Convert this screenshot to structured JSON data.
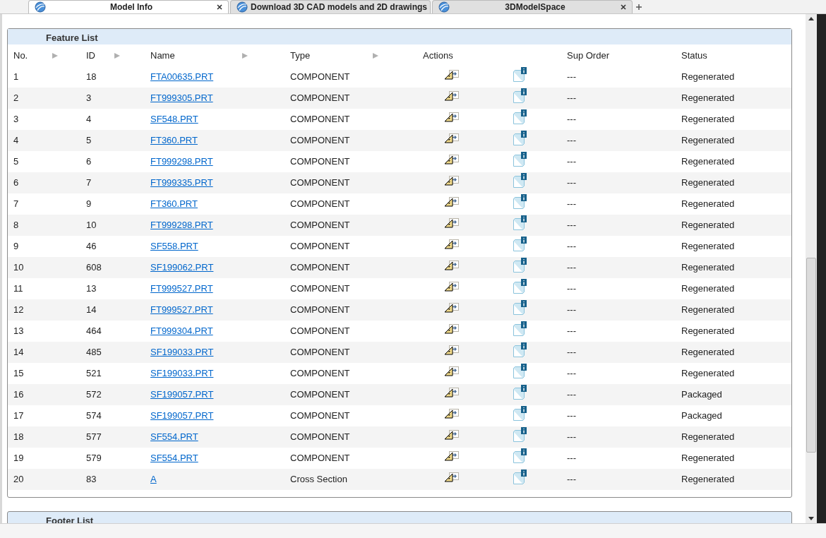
{
  "tabs": [
    {
      "label": "Model Info",
      "selected": true
    },
    {
      "label": "Download 3D CAD models and 2D drawings",
      "selected": false
    },
    {
      "label": "3DModelSpace",
      "selected": false
    }
  ],
  "feature_list": {
    "title": "Feature List",
    "columns": [
      {
        "label": "No.",
        "sortable": true
      },
      {
        "label": "ID",
        "sortable": true
      },
      {
        "label": "Name",
        "sortable": true
      },
      {
        "label": "Type",
        "sortable": true
      },
      {
        "label": "Actions",
        "sortable": false
      },
      {
        "label": "Sup Order",
        "sortable": false
      },
      {
        "label": "Status",
        "sortable": false
      }
    ],
    "rows": [
      {
        "no": "1",
        "id": "18",
        "name": "FTA00635.PRT",
        "type": "COMPONENT",
        "sup_order": "---",
        "status": "Regenerated"
      },
      {
        "no": "2",
        "id": "3",
        "name": "FT999305.PRT",
        "type": "COMPONENT",
        "sup_order": "---",
        "status": "Regenerated"
      },
      {
        "no": "3",
        "id": "4",
        "name": "SF548.PRT",
        "type": "COMPONENT",
        "sup_order": "---",
        "status": "Regenerated"
      },
      {
        "no": "4",
        "id": "5",
        "name": "FT360.PRT",
        "type": "COMPONENT",
        "sup_order": "---",
        "status": "Regenerated"
      },
      {
        "no": "5",
        "id": "6",
        "name": "FT999298.PRT",
        "type": "COMPONENT",
        "sup_order": "---",
        "status": "Regenerated"
      },
      {
        "no": "6",
        "id": "7",
        "name": "FT999335.PRT",
        "type": "COMPONENT",
        "sup_order": "---",
        "status": "Regenerated"
      },
      {
        "no": "7",
        "id": "9",
        "name": "FT360.PRT",
        "type": "COMPONENT",
        "sup_order": "---",
        "status": "Regenerated"
      },
      {
        "no": "8",
        "id": "10",
        "name": "FT999298.PRT",
        "type": "COMPONENT",
        "sup_order": "---",
        "status": "Regenerated"
      },
      {
        "no": "9",
        "id": "46",
        "name": "SF558.PRT",
        "type": "COMPONENT",
        "sup_order": "---",
        "status": "Regenerated"
      },
      {
        "no": "10",
        "id": "608",
        "name": "SF199062.PRT",
        "type": "COMPONENT",
        "sup_order": "---",
        "status": "Regenerated"
      },
      {
        "no": "11",
        "id": "13",
        "name": "FT999527.PRT",
        "type": "COMPONENT",
        "sup_order": "---",
        "status": "Regenerated"
      },
      {
        "no": "12",
        "id": "14",
        "name": "FT999527.PRT",
        "type": "COMPONENT",
        "sup_order": "---",
        "status": "Regenerated"
      },
      {
        "no": "13",
        "id": "464",
        "name": "FT999304.PRT",
        "type": "COMPONENT",
        "sup_order": "---",
        "status": "Regenerated"
      },
      {
        "no": "14",
        "id": "485",
        "name": "SF199033.PRT",
        "type": "COMPONENT",
        "sup_order": "---",
        "status": "Regenerated"
      },
      {
        "no": "15",
        "id": "521",
        "name": "SF199033.PRT",
        "type": "COMPONENT",
        "sup_order": "---",
        "status": "Regenerated"
      },
      {
        "no": "16",
        "id": "572",
        "name": "SF199057.PRT",
        "type": "COMPONENT",
        "sup_order": "---",
        "status": "Packaged"
      },
      {
        "no": "17",
        "id": "574",
        "name": "SF199057.PRT",
        "type": "COMPONENT",
        "sup_order": "---",
        "status": "Packaged"
      },
      {
        "no": "18",
        "id": "577",
        "name": "SF554.PRT",
        "type": "COMPONENT",
        "sup_order": "---",
        "status": "Regenerated"
      },
      {
        "no": "19",
        "id": "579",
        "name": "SF554.PRT",
        "type": "COMPONENT",
        "sup_order": "---",
        "status": "Regenerated"
      },
      {
        "no": "20",
        "id": "83",
        "name": "A",
        "type": "Cross Section",
        "sup_order": "---",
        "status": "Regenerated"
      }
    ]
  },
  "footer_list": {
    "title": "Footer List"
  }
}
